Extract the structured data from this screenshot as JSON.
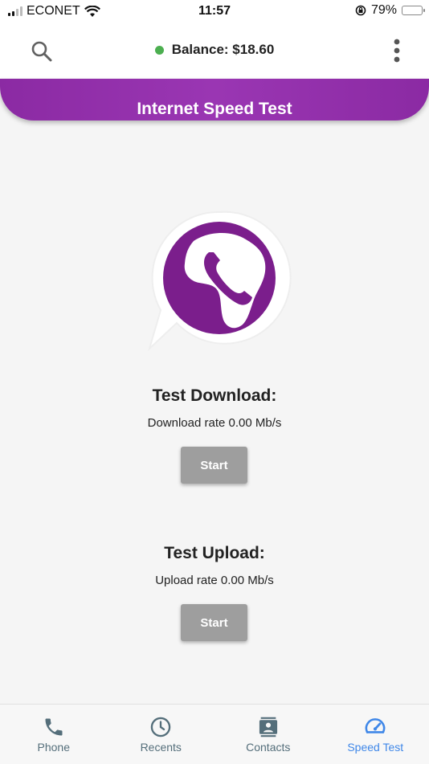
{
  "status_bar": {
    "carrier": "ECONET",
    "time": "11:57",
    "battery_percent": "79%",
    "battery_level": 0.79,
    "battery_color": "#f5c518"
  },
  "app_bar": {
    "search_icon": "search-icon",
    "balance_text": "Balance: $18.60",
    "status_dot_color": "#4caf50",
    "menu_icon": "more-vertical-icon"
  },
  "banner": {
    "title": "Internet Speed Test",
    "color": "#8b2aa3"
  },
  "logo": {
    "icon": "africa-phone-logo-icon",
    "color": "#7b1e8c"
  },
  "download": {
    "title": "Test Download:",
    "rate_text": "Download rate  0.00 Mb/s",
    "button_label": "Start"
  },
  "upload": {
    "title": "Test Upload:",
    "rate_text": "Upload rate 0.00 Mb/s",
    "button_label": "Start"
  },
  "bottom_nav": {
    "active_color": "#3f87e8",
    "inactive_color": "#546e7a",
    "items": [
      {
        "label": "Phone",
        "icon": "phone-icon",
        "active": false
      },
      {
        "label": "Recents",
        "icon": "clock-icon",
        "active": false
      },
      {
        "label": "Contacts",
        "icon": "contacts-icon",
        "active": false
      },
      {
        "label": "Speed Test",
        "icon": "speedometer-icon",
        "active": true
      }
    ]
  }
}
